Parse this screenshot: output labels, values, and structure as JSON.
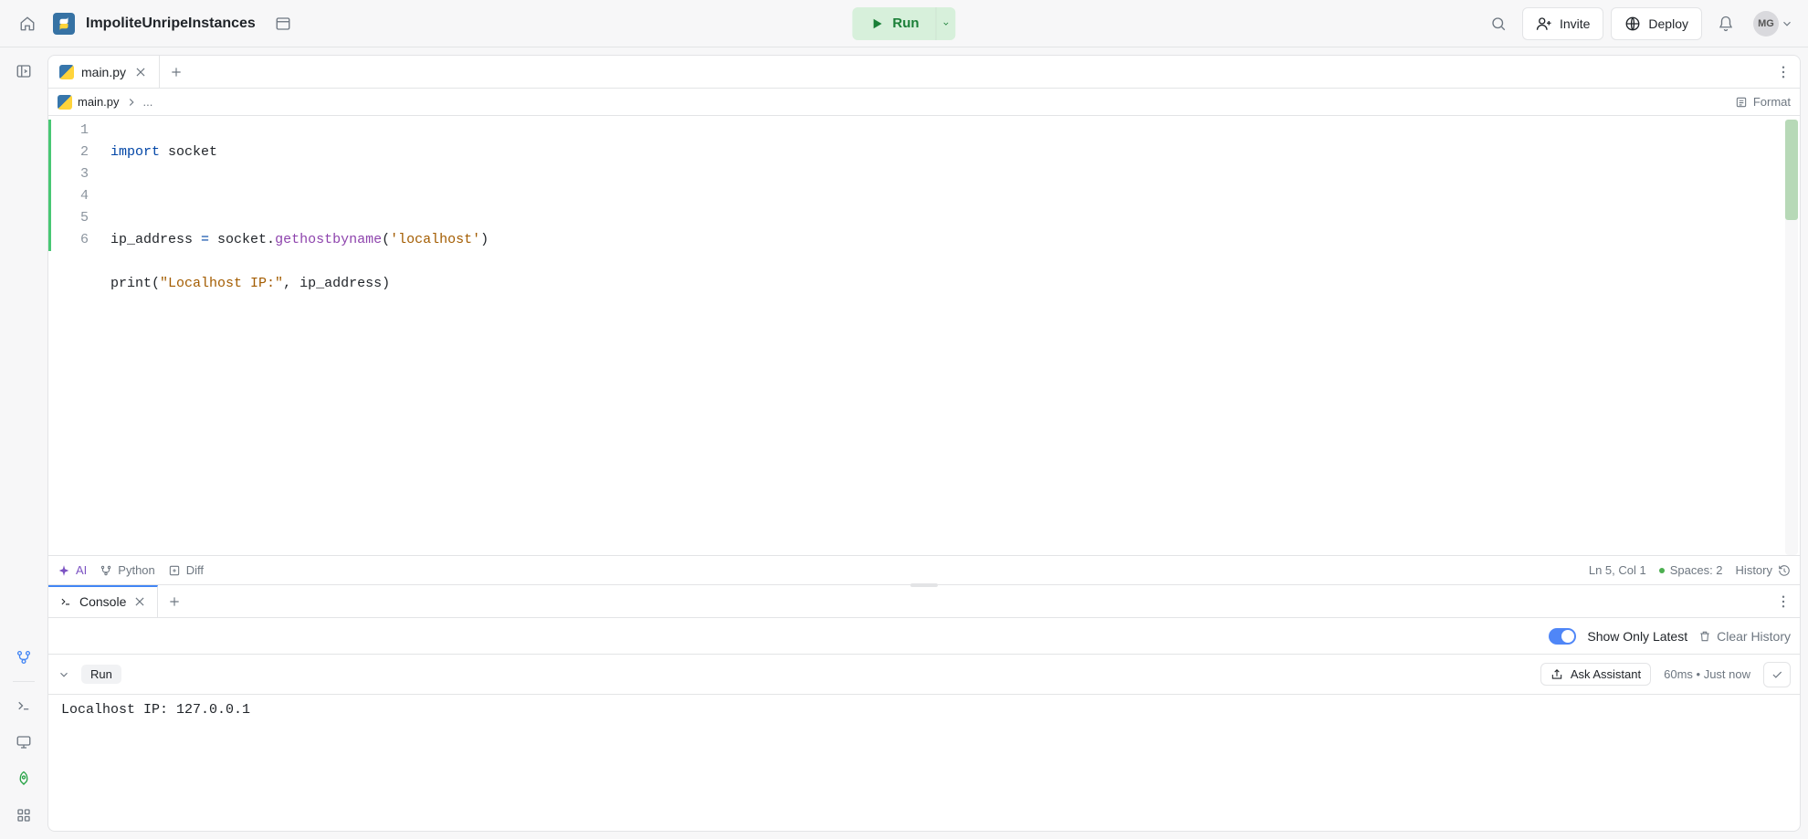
{
  "header": {
    "repl_name": "ImpoliteUnripeInstances",
    "run_label": "Run",
    "invite_label": "Invite",
    "deploy_label": "Deploy",
    "avatar_initials": "MG"
  },
  "editor": {
    "tab": {
      "filename": "main.py"
    },
    "breadcrumb": {
      "filename": "main.py",
      "rest": "..."
    },
    "format_label": "Format",
    "line_numbers": [
      "1",
      "2",
      "3",
      "4",
      "5",
      "6"
    ],
    "code": {
      "l1_kw": "import",
      "l1_rest": " socket",
      "l3_a": "ip_address ",
      "l3_eq": "=",
      "l3_b": " socket.",
      "l3_fn": "gethostbyname",
      "l3_c": "(",
      "l3_str": "'localhost'",
      "l3_d": ")",
      "l4_a": "print",
      "l4_b": "(",
      "l4_str": "\"Localhost IP:\"",
      "l4_c": ", ip_address)"
    }
  },
  "status": {
    "ai": "AI",
    "python": "Python",
    "diff": "Diff",
    "ln_col": "Ln 5, Col 1",
    "spaces": "Spaces: 2",
    "history": "History"
  },
  "console": {
    "tab_label": "Console",
    "show_only_latest": "Show Only Latest",
    "clear_history": "Clear History",
    "run_badge": "Run",
    "ask_assistant": "Ask Assistant",
    "timing": "60ms • Just now",
    "output": "Localhost IP: 127.0.0.1"
  }
}
